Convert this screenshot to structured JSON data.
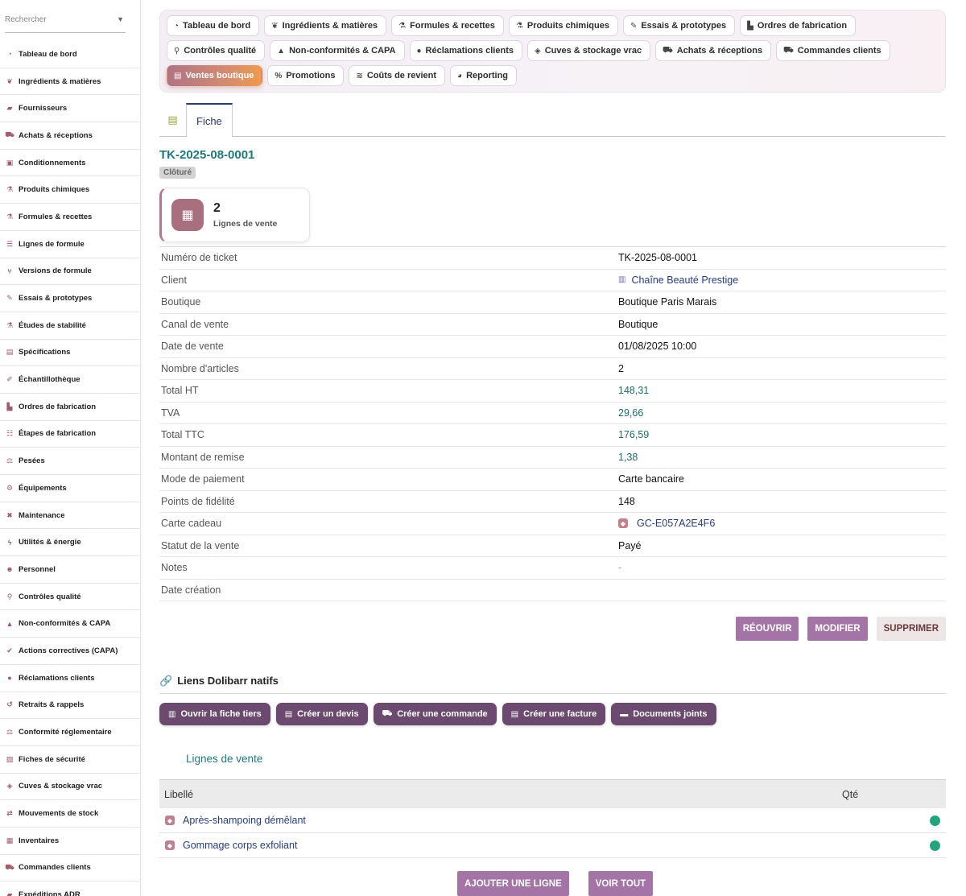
{
  "sidebar": {
    "search_placeholder": "Rechercher",
    "items": [
      {
        "label": "Tableau de bord",
        "icon": "dashboard-icon"
      },
      {
        "label": "Ingrédients & matières",
        "icon": "leaf-icon"
      },
      {
        "label": "Fournisseurs",
        "icon": "truck-icon"
      },
      {
        "label": "Achats & réceptions",
        "icon": "cart-icon"
      },
      {
        "label": "Conditionnements",
        "icon": "box-icon"
      },
      {
        "label": "Produits chimiques",
        "icon": "flask-icon"
      },
      {
        "label": "Formules & recettes",
        "icon": "beaker-icon"
      },
      {
        "label": "Lignes de formule",
        "icon": "list-icon"
      },
      {
        "label": "Versions de formule",
        "icon": "branch-icon"
      },
      {
        "label": "Essais & prototypes",
        "icon": "pipette-icon"
      },
      {
        "label": "Études de stabilité",
        "icon": "flask-icon"
      },
      {
        "label": "Spécifications",
        "icon": "clipboard-icon"
      },
      {
        "label": "Échantillothèque",
        "icon": "dropper-icon"
      },
      {
        "label": "Ordres de fabrication",
        "icon": "factory-icon"
      },
      {
        "label": "Étapes de fabrication",
        "icon": "steps-icon"
      },
      {
        "label": "Pesées",
        "icon": "scale-icon"
      },
      {
        "label": "Équipements",
        "icon": "gears-icon"
      },
      {
        "label": "Maintenance",
        "icon": "tools-icon"
      },
      {
        "label": "Utilités & énergie",
        "icon": "bolt-icon"
      },
      {
        "label": "Personnel",
        "icon": "users-icon"
      },
      {
        "label": "Contrôles qualité",
        "icon": "microscope-icon"
      },
      {
        "label": "Non-conformités & CAPA",
        "icon": "warning-icon"
      },
      {
        "label": "Actions correctives (CAPA)",
        "icon": "check-icon"
      },
      {
        "label": "Réclamations clients",
        "icon": "comment-icon"
      },
      {
        "label": "Retraits & rappels",
        "icon": "undo-icon"
      },
      {
        "label": "Conformité réglementaire",
        "icon": "scale-icon"
      },
      {
        "label": "Fiches de sécurité",
        "icon": "shield-icon"
      },
      {
        "label": "Cuves & stockage vrac",
        "icon": "tank-icon"
      },
      {
        "label": "Mouvements de stock",
        "icon": "arrows-icon"
      },
      {
        "label": "Inventaires",
        "icon": "boxes-icon"
      },
      {
        "label": "Commandes clients",
        "icon": "cart-icon"
      },
      {
        "label": "Expéditions ADR",
        "icon": "truck-icon"
      }
    ]
  },
  "nav": {
    "rows": [
      [
        {
          "label": "Tableau de bord",
          "icon": "dashboard-icon"
        },
        {
          "label": "Ingrédients & matières",
          "icon": "leaf-icon"
        },
        {
          "label": "Formules & recettes",
          "icon": "beaker-icon"
        },
        {
          "label": "Produits chimiques",
          "icon": "flask-icon"
        },
        {
          "label": "Essais & prototypes",
          "icon": "pipette-icon"
        },
        {
          "label": "Ordres de fabrication",
          "icon": "factory-icon"
        }
      ],
      [
        {
          "label": "Contrôles qualité",
          "icon": "microscope-icon"
        },
        {
          "label": "Non-conformités & CAPA",
          "icon": "warning-icon"
        },
        {
          "label": "Réclamations clients",
          "icon": "comment-icon"
        },
        {
          "label": "Cuves & stockage vrac",
          "icon": "tank-icon"
        },
        {
          "label": "Achats & réceptions",
          "icon": "cart-icon"
        },
        {
          "label": "Commandes clients",
          "icon": "cart-icon"
        }
      ],
      [
        {
          "label": "Ventes boutique",
          "icon": "register-icon",
          "active": true
        },
        {
          "label": "Promotions",
          "icon": "percent-icon"
        },
        {
          "label": "Coûts de revient",
          "icon": "coins-icon"
        },
        {
          "label": "Reporting",
          "icon": "chart-pie-icon"
        }
      ]
    ]
  },
  "tabs": {
    "fiche": "Fiche"
  },
  "record": {
    "ref": "TK-2025-08-0001",
    "status_badge": "Clôturé",
    "stat": {
      "value": "2",
      "label": "Lignes de vente"
    }
  },
  "fields": [
    {
      "label": "Numéro de ticket",
      "value": "TK-2025-08-0001",
      "kind": "text"
    },
    {
      "label": "Client",
      "value": "Chaîne Beauté Prestige",
      "kind": "link-building"
    },
    {
      "label": "Boutique",
      "value": "Boutique Paris Marais",
      "kind": "text"
    },
    {
      "label": "Canal de vente",
      "value": "Boutique",
      "kind": "text"
    },
    {
      "label": "Date de vente",
      "value": "01/08/2025 10:00",
      "kind": "text"
    },
    {
      "label": "Nombre d'articles",
      "value": "2",
      "kind": "text"
    },
    {
      "label": "Total HT",
      "value": "148,31",
      "kind": "amount"
    },
    {
      "label": "TVA",
      "value": "29,66",
      "kind": "amount"
    },
    {
      "label": "Total TTC",
      "value": "176,59",
      "kind": "amount"
    },
    {
      "label": "Montant de remise",
      "value": "1,38",
      "kind": "amount"
    },
    {
      "label": "Mode de paiement",
      "value": "Carte bancaire",
      "kind": "text"
    },
    {
      "label": "Points de fidélité",
      "value": "148",
      "kind": "text"
    },
    {
      "label": "Carte cadeau",
      "value": "GC-E057A2E4F6",
      "kind": "link-gift"
    },
    {
      "label": "Statut de la vente",
      "value": "Payé",
      "kind": "text"
    },
    {
      "label": "Notes",
      "value": "-",
      "kind": "dash"
    },
    {
      "label": "Date création",
      "value": "",
      "kind": "text"
    }
  ],
  "actions": {
    "reopen": "RÉOUVRIR",
    "edit": "MODIFIER",
    "delete": "SUPPRIMER"
  },
  "dolibarr": {
    "title": "Liens Dolibarr natifs",
    "buttons": [
      {
        "label": "Ouvrir la fiche tiers",
        "icon": "building-icon"
      },
      {
        "label": "Créer un devis",
        "icon": "document-icon"
      },
      {
        "label": "Créer une commande",
        "icon": "cart-icon"
      },
      {
        "label": "Créer une facture",
        "icon": "invoice-icon"
      },
      {
        "label": "Documents joints",
        "icon": "folder-icon"
      }
    ]
  },
  "lines": {
    "title": "Lignes de vente",
    "columns": [
      "Libellé",
      "Qté"
    ],
    "rows": [
      {
        "label": "Après-shampoing démêlant"
      },
      {
        "label": "Gommage corps exfoliant"
      }
    ],
    "status_color": "#22a57a"
  },
  "bottom_actions": {
    "add_line": "AJOUTER UNE LIGNE",
    "view_all": "VOIR TOUT"
  },
  "colors": {
    "accent": "#a574a7",
    "ref_teal": "#1f7a7c",
    "dolibarr_btn": "#6c4a6f"
  }
}
